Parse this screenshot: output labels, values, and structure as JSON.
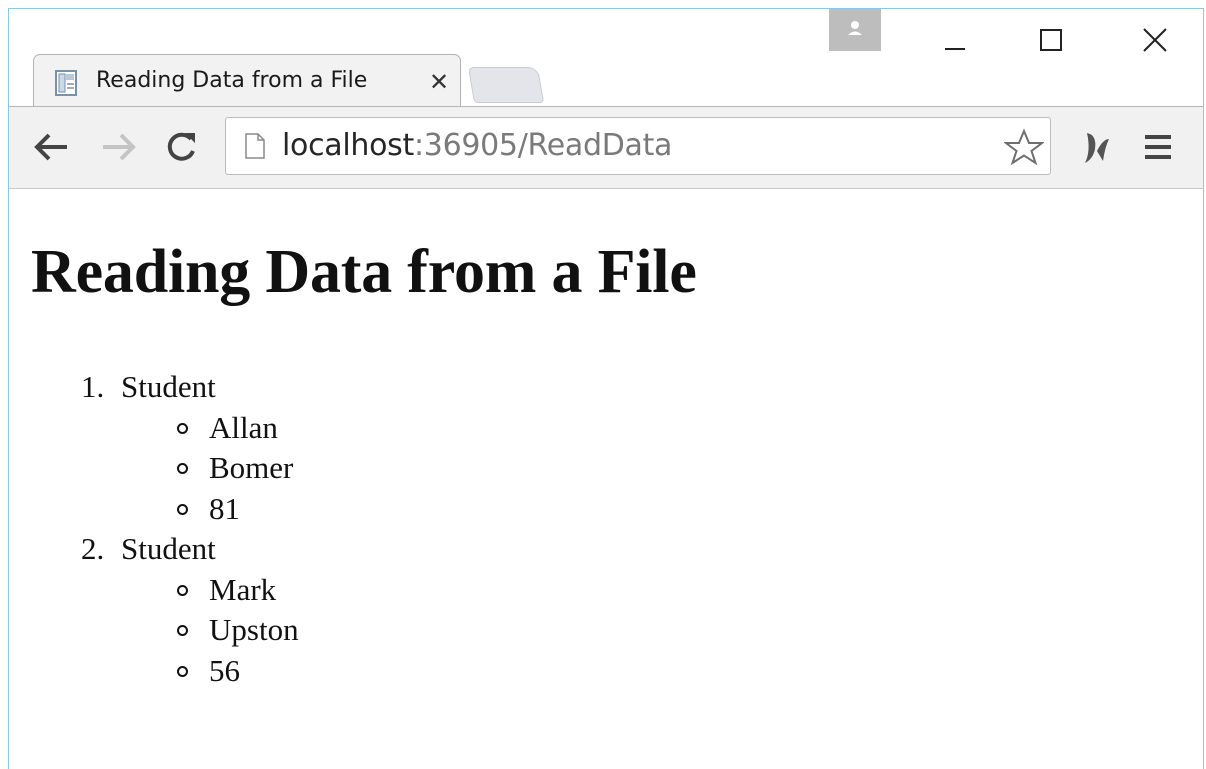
{
  "browser": {
    "tab": {
      "title": "Reading Data from a File",
      "close_glyph": "✕"
    },
    "address_bar": {
      "host": "localhost",
      "rest": ":36905/ReadData"
    },
    "icons": [
      "page-favicon-icon",
      "profile-icon",
      "minimize-icon",
      "maximize-icon",
      "close-icon",
      "back-icon",
      "forward-icon",
      "reload-icon",
      "page-icon",
      "star-icon",
      "extension-icon",
      "menu-icon"
    ]
  },
  "page": {
    "heading": "Reading Data from a File",
    "students": [
      {
        "number": "1.",
        "label": "Student",
        "first_name": "Allan",
        "last_name": "Bomer",
        "score": "81"
      },
      {
        "number": "2.",
        "label": "Student",
        "first_name": "Mark",
        "last_name": "Upston",
        "score": "56"
      }
    ]
  },
  "colors": {
    "window_border": "#8cc8e6",
    "toolbar_bg": "#f1f1f1",
    "tab_bg": "#f2f2f2",
    "profile_bg": "#bdbdbd"
  }
}
